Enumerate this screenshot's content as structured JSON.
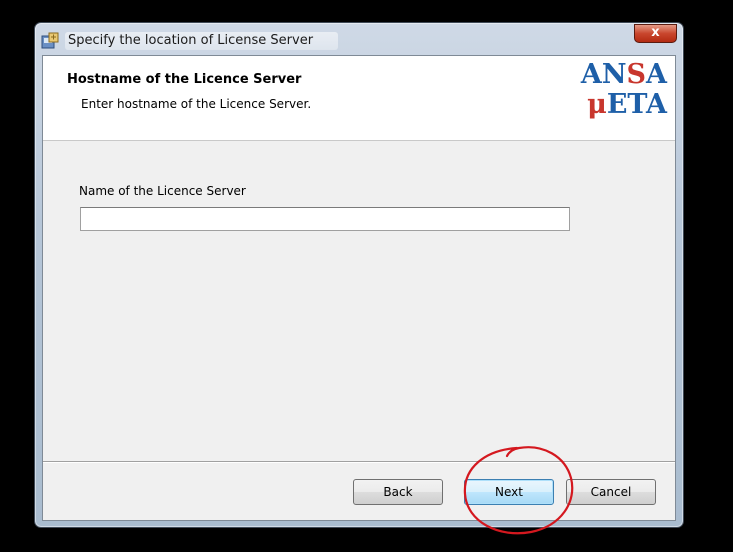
{
  "window": {
    "title": "Specify the location of License Server",
    "close_symbol": "x"
  },
  "banner": {
    "title": "Hostname of the Licence Server",
    "subtitle": "Enter hostname of the Licence Server.",
    "logo_line1": "ANSA",
    "logo_line2": "μETA"
  },
  "form": {
    "field_label": "Name of the Licence Server",
    "field_value": ""
  },
  "buttons": {
    "back": "Back",
    "next": "Next",
    "cancel": "Cancel"
  },
  "colors": {
    "logo_blue": "#1e5fa8",
    "logo_red": "#c8362d",
    "annotation": "#d4181f"
  },
  "icons": {
    "window_icon": "installer-icon",
    "annotation": "hand-drawn-circle"
  }
}
